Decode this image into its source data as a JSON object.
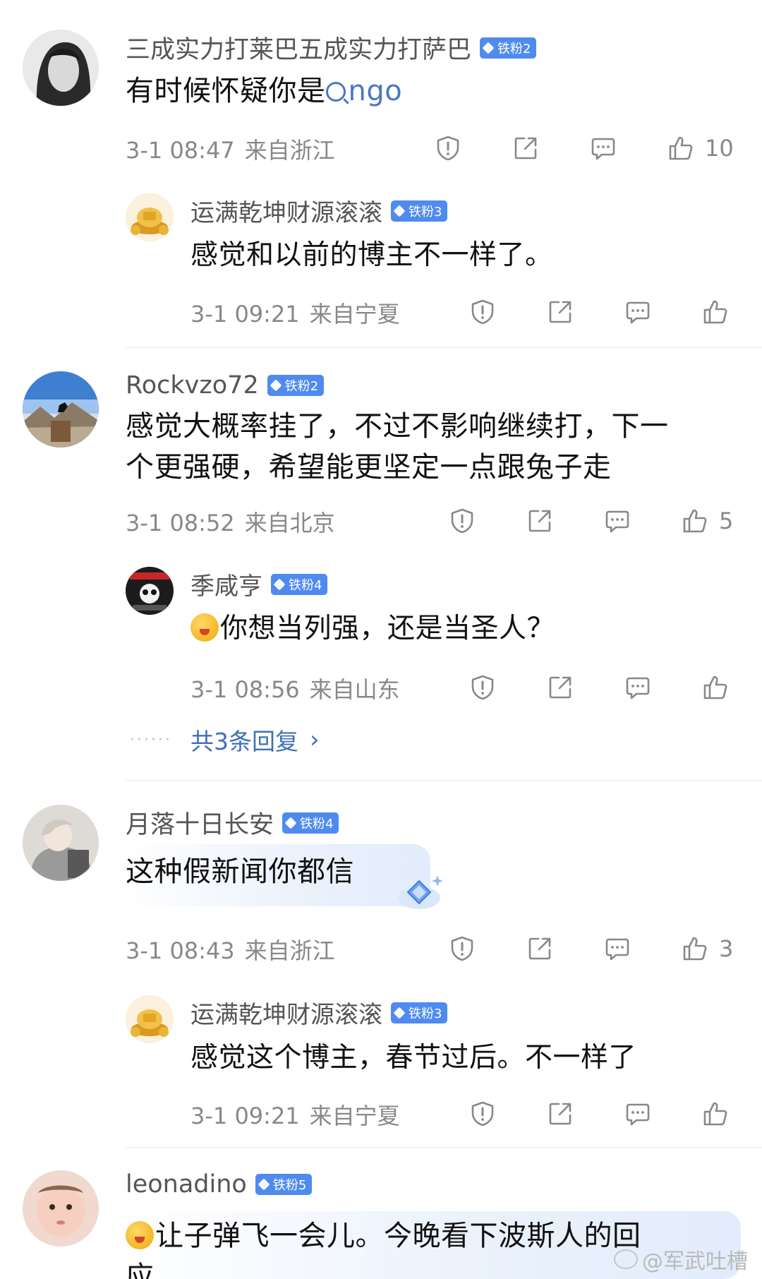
{
  "comments": [
    {
      "user": "三成实力打莱巴五成实力打萨巴",
      "badge": "铁粉2",
      "text_before": "有时候怀疑你是",
      "link": "ngo",
      "date": "3-1 08:47",
      "location": "来自浙江",
      "likes": "10",
      "avatar_color": "#cfcfcf",
      "reply": {
        "user": "运满乾坤财源滚滚",
        "badge": "铁粉3",
        "text": "感觉和以前的博主不一样了。",
        "date": "3-1 09:21",
        "location": "来自宁夏"
      }
    },
    {
      "user": "Rockvzo72",
      "badge": "铁粉2",
      "text_line1": "感觉大概率挂了，不过不影响继续打，下一",
      "text_line2": "个更强硬，希望能更坚定一点跟兔子走",
      "date": "3-1 08:52",
      "location": "来自北京",
      "likes": "5",
      "reply": {
        "user": "季咸亨",
        "badge": "铁粉4",
        "text": "你想当列强，还是当圣人？",
        "date": "3-1 08:56",
        "location": "来自山东"
      },
      "more_replies": "共3条回复"
    },
    {
      "user": "月落十日长安",
      "badge": "铁粉4",
      "text": "这种假新闻你都信",
      "date": "3-1 08:43",
      "location": "来自浙江",
      "likes": "3",
      "reply": {
        "user": "运满乾坤财源滚滚",
        "badge": "铁粉3",
        "text": "感觉这个博主，春节过后。不一样了",
        "date": "3-1 09:21",
        "location": "来自宁夏"
      }
    },
    {
      "user": "leonadino",
      "badge": "铁粉5",
      "text_line1": "让子弹飞一会儿。今晚看下波斯人的回",
      "text_line2": "应"
    }
  ],
  "watermark": "@军武吐槽",
  "icons": {
    "report": "shield-alert-icon",
    "share": "share-icon",
    "comment": "comment-icon",
    "like": "thumbs-up-icon"
  },
  "colors": {
    "badge": "#4f8bef",
    "link": "#4a78c4",
    "meta": "#888888"
  }
}
